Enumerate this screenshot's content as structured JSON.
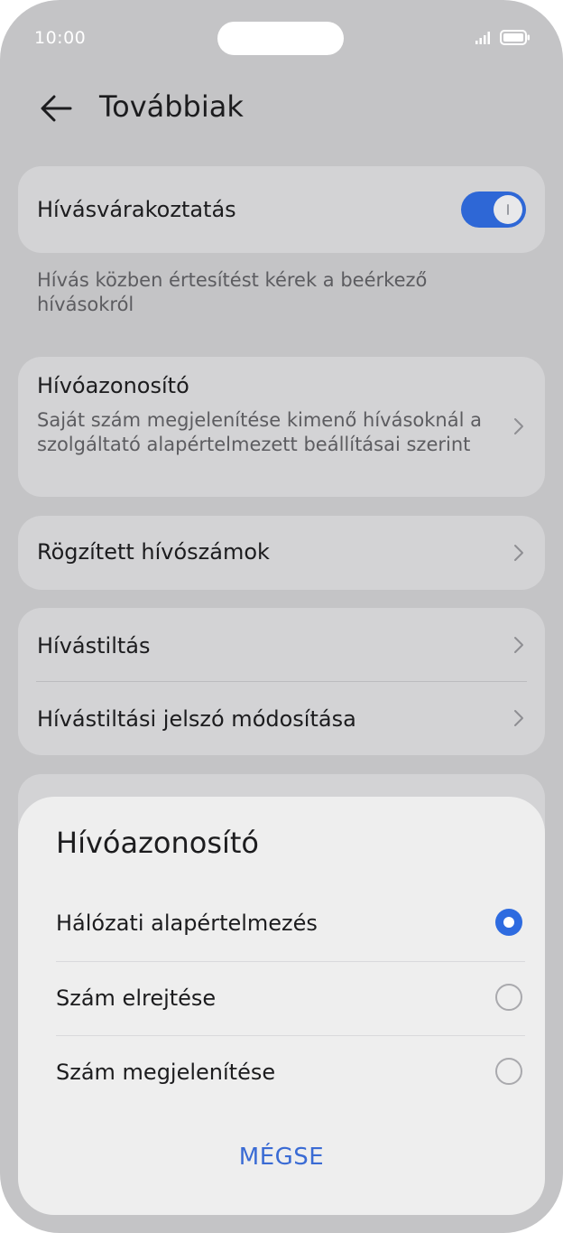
{
  "status_bar": {
    "time": "10:00"
  },
  "header": {
    "title": "Továbbiak"
  },
  "settings": {
    "call_waiting": {
      "label": "Hívásvárakoztatás",
      "enabled": true,
      "helper": "Hívás közben értesítést kérek a beérkező hívásokról"
    },
    "caller_id": {
      "label": "Hívóazonosító",
      "subtitle": "Saját szám megjelenítése kimenő hívásoknál a szolgáltató alapértelmezett beállításai szerint"
    },
    "fixed_numbers": {
      "label": "Rögzített hívószámok"
    },
    "call_barring": {
      "label": "Hívástiltás"
    },
    "barring_password": {
      "label": "Hívástiltási jelszó módosítása"
    }
  },
  "dialog": {
    "title": "Hívóazonosító",
    "options": [
      {
        "label": "Hálózati alapértelmezés",
        "selected": true
      },
      {
        "label": "Szám elrejtése",
        "selected": false
      },
      {
        "label": "Szám megjelenítése",
        "selected": false
      }
    ],
    "cancel_label": "MÉGSE"
  },
  "colors": {
    "accent": "#2e6be0",
    "toggle_on": "#2e67d6",
    "dim_background": "#c4c4c6",
    "sheet_background": "#eeeeee"
  }
}
